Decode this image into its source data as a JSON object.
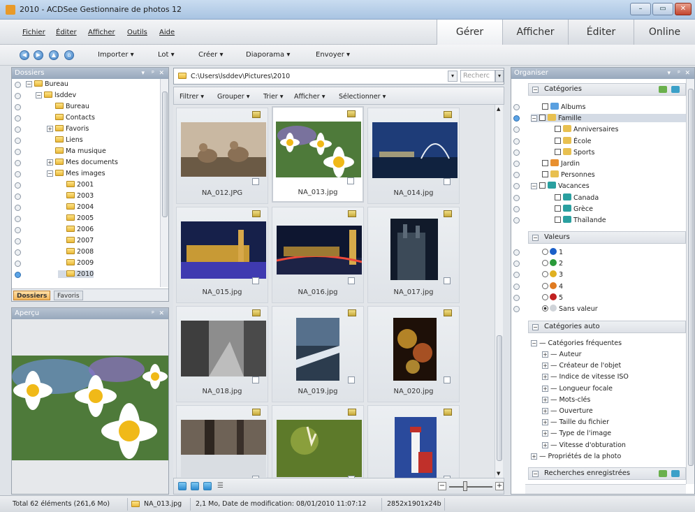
{
  "window": {
    "title": "2010 - ACDSee Gestionnaire de photos 12"
  },
  "menu": {
    "items": [
      "Fichier",
      "Éditer",
      "Afficher",
      "Outils",
      "Aide"
    ]
  },
  "modes": [
    "Gérer",
    "Afficher",
    "Éditer",
    "Online"
  ],
  "toolbar": {
    "buttons": [
      "Importer",
      "Lot",
      "Créer",
      "Diaporama",
      "Envoyer"
    ]
  },
  "folders": {
    "title": "Dossiers",
    "tree": [
      "Bureau",
      "lsddev",
      "Bureau",
      "Contacts",
      "Favoris",
      "Liens",
      "Ma musique",
      "Mes documents",
      "Mes images",
      "2001",
      "2003",
      "2004",
      "2005",
      "2006",
      "2007",
      "2008",
      "2009",
      "2010"
    ],
    "tabs": [
      "Dossiers",
      "Favoris"
    ]
  },
  "preview": {
    "title": "Aperçu"
  },
  "path": {
    "value": "C:\\Users\\lsddev\\Pictures\\2010",
    "search_placeholder": "Recherc"
  },
  "filterbar": {
    "items": [
      "Filtrer",
      "Grouper",
      "Trier",
      "Afficher",
      "Sélectionner"
    ]
  },
  "thumbnails": [
    "NA_012.JPG",
    "NA_013.jpg",
    "NA_014.jpg",
    "NA_015.jpg",
    "NA_016.jpg",
    "NA_017.jpg",
    "NA_018.jpg",
    "NA_019.jpg",
    "NA_020.jpg",
    "",
    "",
    ""
  ],
  "organizer": {
    "title": "Organiser",
    "categories_header": "Catégories",
    "categories": [
      "Albums",
      "Famille",
      "Anniversaires",
      "École",
      "Sports",
      "Jardin",
      "Personnes",
      "Vacances",
      "Canada",
      "Grèce",
      "Thaïlande"
    ],
    "ratings_header": "Valeurs",
    "ratings": [
      "1",
      "2",
      "3",
      "4",
      "5",
      "Sans valeur"
    ],
    "auto_header": "Catégories auto",
    "auto_root": "Catégories fréquentes",
    "auto_items": [
      "Auteur",
      "Créateur de l'objet",
      "Indice de vitesse ISO",
      "Longueur focale",
      "Mots-clés",
      "Ouverture",
      "Taille du fichier",
      "Type de l'image",
      "Vitesse d'obturation"
    ],
    "photo_props": "Propriétés de la photo",
    "saved_header": "Recherches enregistrées"
  },
  "status": {
    "total": "Total 62 éléments  (261,6 Mo)",
    "file": "NA_013.jpg",
    "info": "2,1 Mo, Date de modification: 08/01/2010 11:07:12",
    "dims": "2852x1901x24b"
  },
  "colors": {
    "accent": "#97a8bc",
    "selection": "#c8cdd4"
  }
}
